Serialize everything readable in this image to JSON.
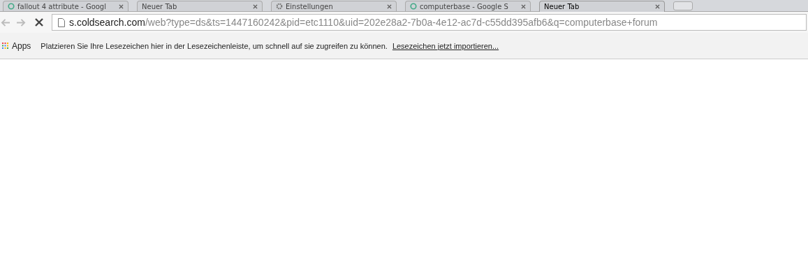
{
  "tabs": [
    {
      "title": "fallout 4 attribute - Googl",
      "kind": "web",
      "selected": false
    },
    {
      "title": "Neuer Tab",
      "kind": "blank",
      "selected": false
    },
    {
      "title": "Einstellungen",
      "kind": "settings",
      "selected": false
    },
    {
      "title": "computerbase - Google S",
      "kind": "web",
      "selected": false
    },
    {
      "title": "Neuer Tab",
      "kind": "blank",
      "selected": true
    }
  ],
  "toolbar": {
    "back_disabled": true,
    "forward_disabled": true,
    "url_host": "s.coldsearch.com",
    "url_path": "/web?type=ds&ts=1447160242&pid=etc1110&uid=202e28a2-7b0a-4e12-ac7d-c55dd395afb6&q=computerbase+forum"
  },
  "bookmarks_bar": {
    "apps": "Apps",
    "hint": "Platzieren Sie Ihre Lesezeichen hier in der Lesezeichenleiste, um schnell auf sie zugreifen zu können.",
    "import_link": "Lesezeichen jetzt importieren..."
  }
}
